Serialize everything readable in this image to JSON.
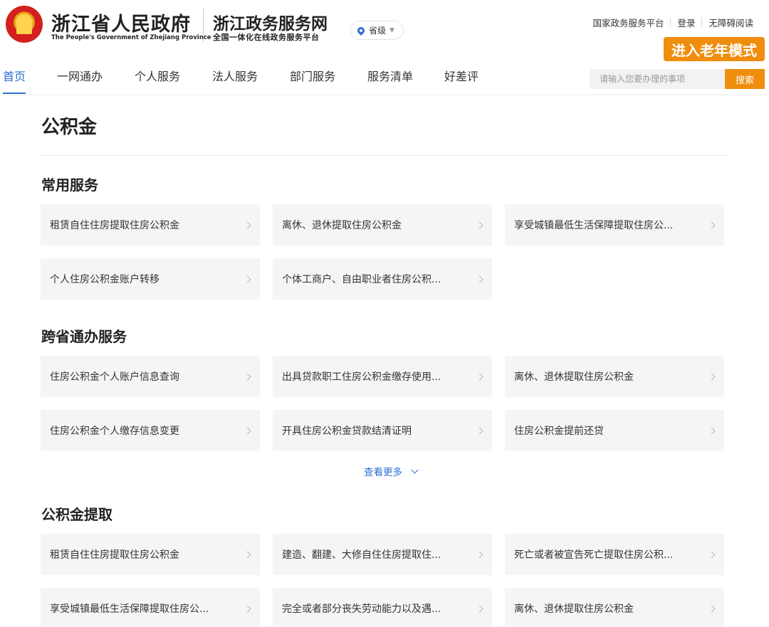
{
  "header": {
    "gov_title": "浙江省人民政府",
    "gov_title_en": "The People's Government of Zhejiang Province",
    "site_title": "浙江政务服务网",
    "site_subtitle": "全国一体化在线政务服务平台",
    "region": "省级",
    "top_links": [
      "国家政务服务平台",
      "登录",
      "无障碍阅读"
    ],
    "elder_mode": "进入老年模式",
    "nav": [
      "首页",
      "一网通办",
      "个人服务",
      "法人服务",
      "部门服务",
      "服务清单",
      "好差评"
    ],
    "active_nav": "首页",
    "search_placeholder": "请输入您要办理的事项",
    "search_button": "搜索"
  },
  "page": {
    "title": "公积金"
  },
  "sections": [
    {
      "title": "常用服务",
      "items": [
        "租赁自住住房提取住房公积金",
        "离休、退休提取住房公积金",
        "享受城镇最低生活保障提取住房公...",
        "个人住房公积金账户转移",
        "个体工商户、自由职业者住房公积..."
      ]
    },
    {
      "title": "跨省通办服务",
      "items": [
        "住房公积金个人账户信息查询",
        "出具贷款职工住房公积金缴存使用...",
        "离休、退休提取住房公积金",
        "住房公积金个人缴存信息变更",
        "开具住房公积金贷款结清证明",
        "住房公积金提前还贷"
      ],
      "more_label": "查看更多"
    },
    {
      "title": "公积金提取",
      "items": [
        "租赁自住住房提取住房公积金",
        "建造、翻建、大修自住住房提取住...",
        "死亡或者被宣告死亡提取住房公积...",
        "享受城镇最低生活保障提取住房公...",
        "完全或者部分丧失劳动能力以及遇...",
        "离休、退休提取住房公积金"
      ]
    }
  ],
  "colors": {
    "accent_blue": "#2f6fd6",
    "accent_orange": "#f08d0d",
    "card_bg": "#f5f5f5"
  }
}
